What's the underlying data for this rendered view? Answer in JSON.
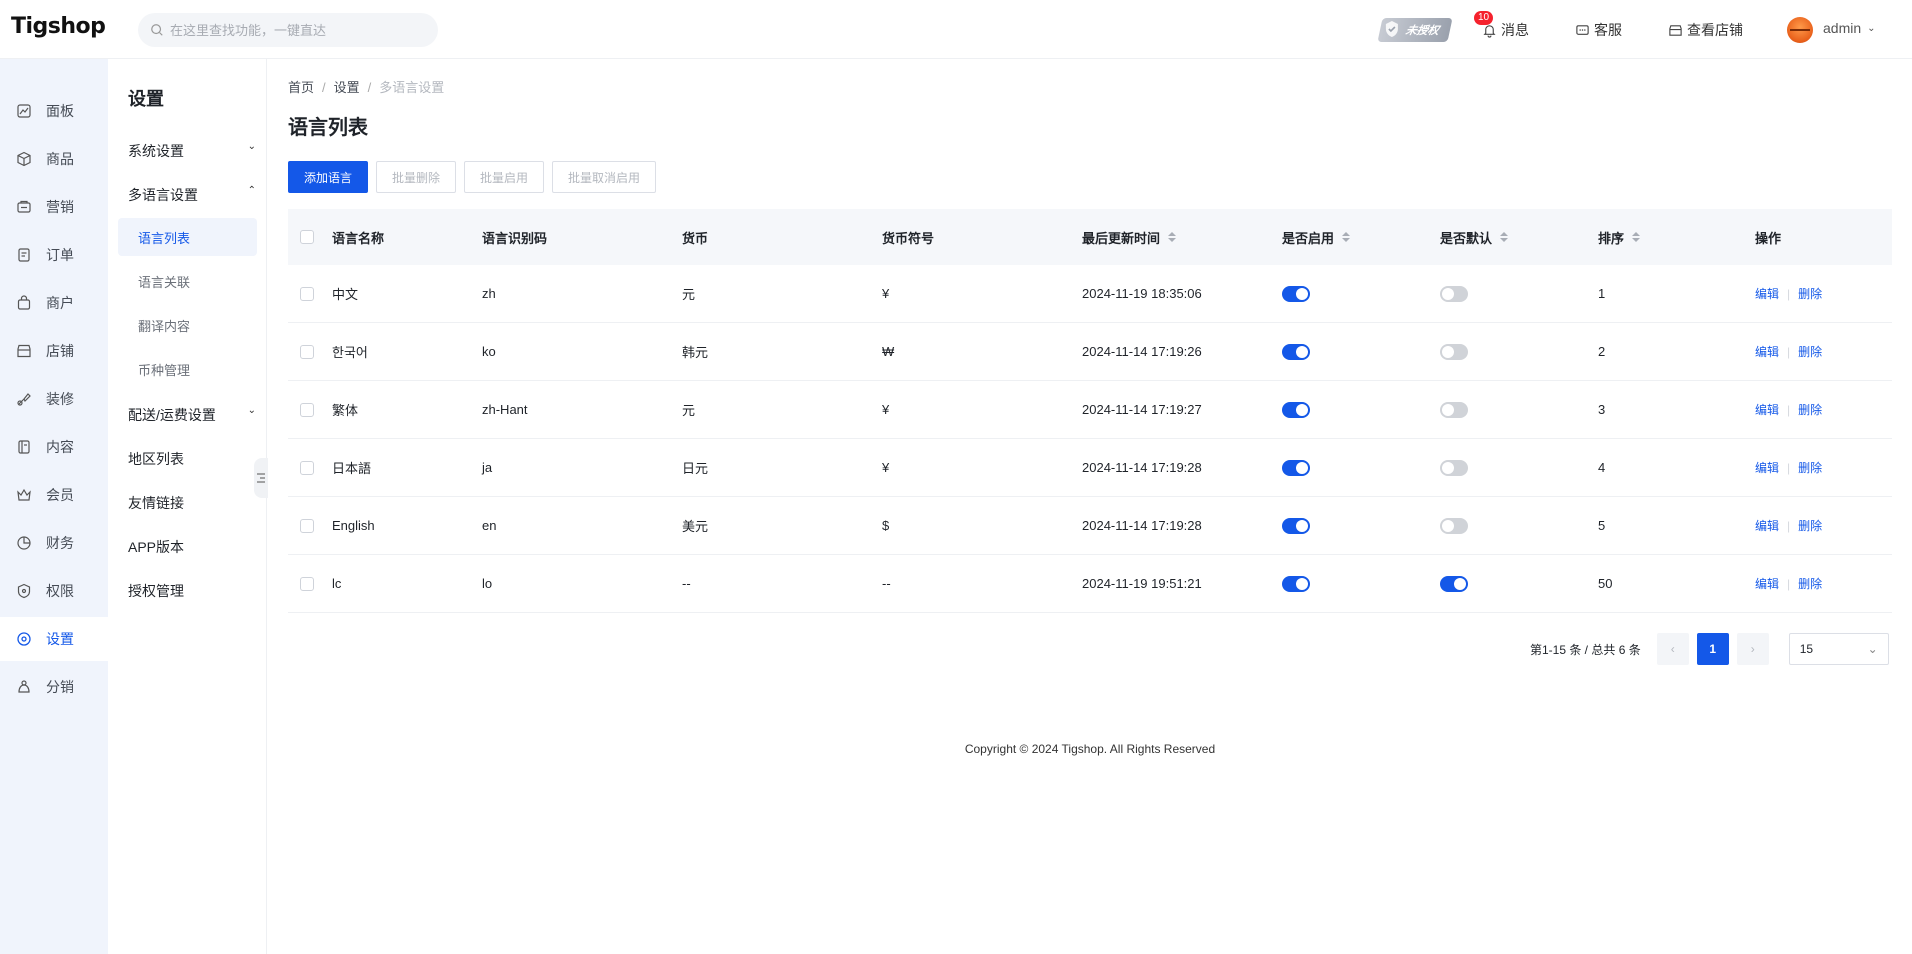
{
  "header": {
    "logo": "Tigshop",
    "search_placeholder": "在这里查找功能，一键直达",
    "auth_badge": "未授权",
    "notif_count": "10",
    "messages": "消息",
    "service": "客服",
    "view_store": "查看店铺",
    "user": "admin"
  },
  "sidebar": {
    "items": [
      {
        "label": "面板",
        "icon": "chart-line-icon"
      },
      {
        "label": "商品",
        "icon": "box-icon"
      },
      {
        "label": "营销",
        "icon": "megaphone-icon"
      },
      {
        "label": "订单",
        "icon": "document-icon"
      },
      {
        "label": "商户",
        "icon": "bag-icon"
      },
      {
        "label": "店铺",
        "icon": "storefront-icon"
      },
      {
        "label": "装修",
        "icon": "brush-icon"
      },
      {
        "label": "内容",
        "icon": "book-icon"
      },
      {
        "label": "会员",
        "icon": "crown-icon"
      },
      {
        "label": "财务",
        "icon": "pie-chart-icon"
      },
      {
        "label": "权限",
        "icon": "shield-icon"
      },
      {
        "label": "设置",
        "icon": "settings-icon"
      },
      {
        "label": "分销",
        "icon": "distribution-icon"
      }
    ],
    "active": "设置"
  },
  "subnav": {
    "title": "设置",
    "system": "系统设置",
    "multilang": "多语言设置",
    "lang_items": [
      "语言列表",
      "语言关联",
      "翻译内容",
      "币种管理"
    ],
    "shipping": "配送/运费设置",
    "region": "地区列表",
    "friend_links": "友情链接",
    "app_version": "APP版本",
    "license": "授权管理"
  },
  "main": {
    "breadcrumb": [
      "首页",
      "设置",
      "多语言设置"
    ],
    "title": "语言列表",
    "buttons": {
      "add": "添加语言",
      "batch_delete": "批量删除",
      "batch_enable": "批量启用",
      "batch_disable": "批量取消启用"
    },
    "columns": {
      "name": "语言名称",
      "code": "语言识别码",
      "currency": "货币",
      "symbol": "货币符号",
      "updated": "最后更新时间",
      "enabled": "是否启用",
      "default": "是否默认",
      "sort": "排序",
      "ops": "操作"
    },
    "rows": [
      {
        "name": "中文",
        "code": "zh",
        "currency": "元",
        "symbol": "¥",
        "updated": "2024-11-19 18:35:06",
        "enabled": true,
        "default": false,
        "sort": "1"
      },
      {
        "name": "한국어",
        "code": "ko",
        "currency": "韩元",
        "symbol": "₩",
        "updated": "2024-11-14 17:19:26",
        "enabled": true,
        "default": false,
        "sort": "2"
      },
      {
        "name": "繁体",
        "code": "zh-Hant",
        "currency": "元",
        "symbol": "¥",
        "updated": "2024-11-14 17:19:27",
        "enabled": true,
        "default": false,
        "sort": "3"
      },
      {
        "name": "日本語",
        "code": "ja",
        "currency": "日元",
        "symbol": "¥",
        "updated": "2024-11-14 17:19:28",
        "enabled": true,
        "default": false,
        "sort": "4"
      },
      {
        "name": "English",
        "code": "en",
        "currency": "美元",
        "symbol": "$",
        "updated": "2024-11-14 17:19:28",
        "enabled": true,
        "default": false,
        "sort": "5"
      },
      {
        "name": "lc",
        "code": "lo",
        "currency": "--",
        "symbol": "--",
        "updated": "2024-11-19 19:51:21",
        "enabled": true,
        "default": true,
        "sort": "50"
      }
    ],
    "op_edit": "编辑",
    "op_delete": "删除",
    "pager": {
      "summary": "第1-15 条 / 总共 6 条",
      "current": "1",
      "page_size": "15"
    },
    "footer": "Copyright © 2024 Tigshop. All Rights Reserved"
  },
  "colors": {
    "primary": "#1458e8",
    "sidebar_bg": "#f0f4fc"
  }
}
